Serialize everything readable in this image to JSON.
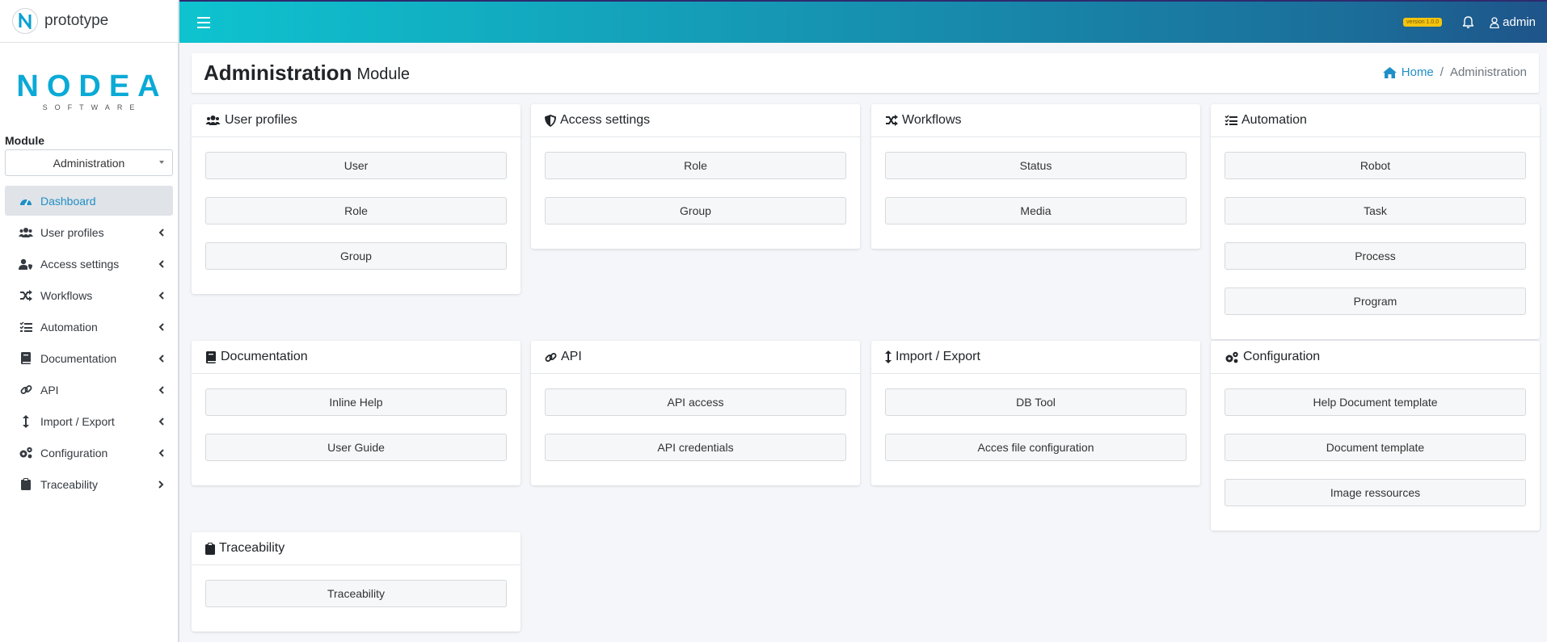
{
  "brand": {
    "name": "prototype",
    "logo_word": "NODEA",
    "logo_sub": "SOFTWARE"
  },
  "sidebar": {
    "module_label": "Module",
    "module_value": "Administration",
    "items": [
      {
        "label": "Dashboard",
        "icon": "dashboard-icon"
      },
      {
        "label": "User profiles",
        "icon": "users-icon"
      },
      {
        "label": "Access settings",
        "icon": "user-shield-icon"
      },
      {
        "label": "Workflows",
        "icon": "random-icon"
      },
      {
        "label": "Automation",
        "icon": "tasks-icon"
      },
      {
        "label": "Documentation",
        "icon": "book-icon"
      },
      {
        "label": "API",
        "icon": "link-icon"
      },
      {
        "label": "Import / Export",
        "icon": "arrows-v-icon"
      },
      {
        "label": "Configuration",
        "icon": "cogs-icon"
      },
      {
        "label": "Traceability",
        "icon": "clipboard-icon"
      }
    ]
  },
  "topbar": {
    "version": "version 1.0.0",
    "user": "admin"
  },
  "header": {
    "title": "Administration",
    "subtitle": "Module",
    "breadcrumb_home": "Home",
    "breadcrumb_sep": "/",
    "breadcrumb_current": "Administration"
  },
  "cards": [
    {
      "title": "User profiles",
      "icon": "users-icon",
      "buttons": [
        "User",
        "Role",
        "Group"
      ]
    },
    {
      "title": "Access settings",
      "icon": "shield-icon",
      "buttons": [
        "Role",
        "Group"
      ]
    },
    {
      "title": "Workflows",
      "icon": "random-icon",
      "buttons": [
        "Status",
        "Media"
      ]
    },
    {
      "title": "Automation",
      "icon": "tasks-icon",
      "buttons": [
        "Robot",
        "Task",
        "Process",
        "Program"
      ]
    },
    {
      "title": "Documentation",
      "icon": "book-icon",
      "buttons": [
        "Inline Help",
        "User Guide"
      ]
    },
    {
      "title": "API",
      "icon": "link-icon",
      "buttons": [
        "API access",
        "API credentials"
      ]
    },
    {
      "title": "Import / Export",
      "icon": "arrows-v-icon",
      "buttons": [
        "DB Tool",
        "Acces file configuration"
      ]
    },
    {
      "title": "Configuration",
      "icon": "cogs-icon",
      "buttons": [
        "Help Document template",
        "Document template",
        "Image ressources"
      ]
    },
    {
      "title": "Traceability",
      "icon": "clipboard-icon",
      "buttons": [
        "Traceability"
      ]
    }
  ],
  "colors": {
    "accent": "#1f8fc7",
    "topbar_start": "#0ec3cf",
    "topbar_end": "#1e5489",
    "version_badge": "#f2c40f"
  }
}
